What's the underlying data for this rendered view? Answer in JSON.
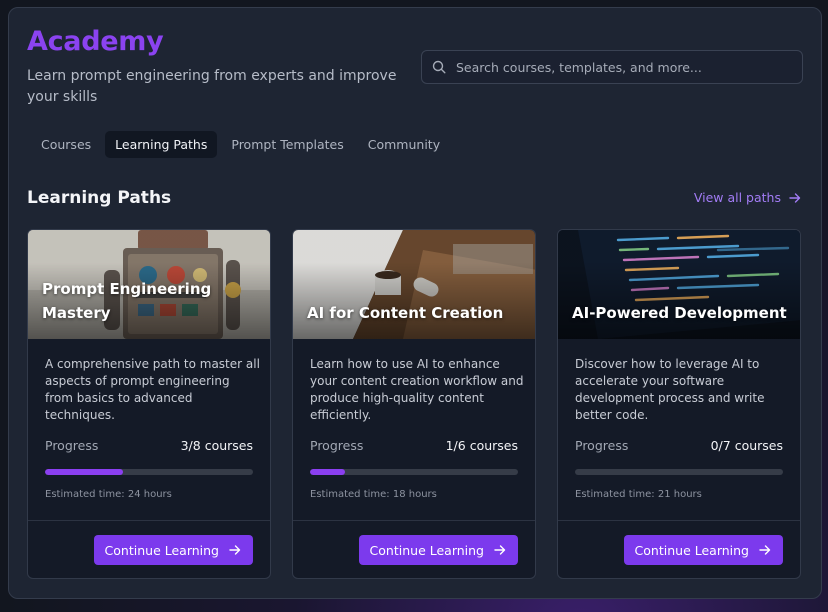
{
  "header": {
    "title": "Academy",
    "subtitle": "Learn prompt engineering from experts and improve your skills",
    "search_placeholder": "Search courses, templates, and more..."
  },
  "tabs": [
    {
      "label": "Courses",
      "active": false
    },
    {
      "label": "Learning Paths",
      "active": true
    },
    {
      "label": "Prompt Templates",
      "active": false
    },
    {
      "label": "Community",
      "active": false
    }
  ],
  "section": {
    "title": "Learning Paths",
    "view_all": "View all paths"
  },
  "colors": {
    "accent": "#8b43f0",
    "button": "#7c3aed",
    "progress_fill": "#8b3ff0"
  },
  "cards": [
    {
      "image_title": "Prompt Engineering Mastery",
      "description": "A comprehensive path to master all aspects of prompt engineering from basics to advanced techniques.",
      "progress_label": "Progress",
      "progress_count": "3/8 courses",
      "progress_fraction": 0.375,
      "estimated_time": "Estimated time: 24 hours",
      "cta": "Continue Learning"
    },
    {
      "image_title": "AI for Content Creation",
      "description": "Learn how to use AI to enhance your content creation workflow and produce high-quality content efficiently.",
      "progress_label": "Progress",
      "progress_count": "1/6 courses",
      "progress_fraction": 0.1667,
      "estimated_time": "Estimated time: 18 hours",
      "cta": "Continue Learning"
    },
    {
      "image_title": "AI-Powered Development",
      "description": "Discover how to leverage AI to accelerate your software development process and write better code.",
      "progress_label": "Progress",
      "progress_count": "0/7 courses",
      "progress_fraction": 0,
      "estimated_time": "Estimated time: 21 hours",
      "cta": "Continue Learning"
    }
  ]
}
